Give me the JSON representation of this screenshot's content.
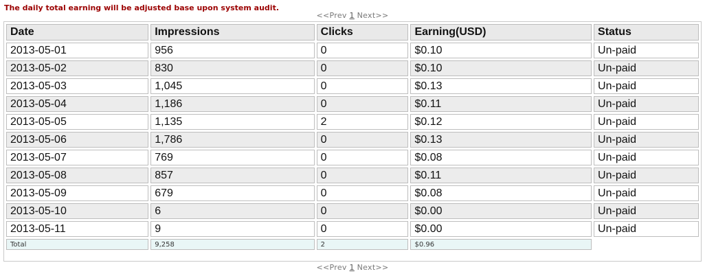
{
  "notice": "The daily total earning will be adjusted base upon system audit.",
  "pager": {
    "prev": "<<Prev",
    "page": "1",
    "next": "Next>>"
  },
  "table": {
    "headers": [
      "Date",
      "Impressions",
      "Clicks",
      "Earning(USD)",
      "Status"
    ],
    "rows": [
      [
        "2013-05-01",
        "956",
        "0",
        "$0.10",
        "Un-paid"
      ],
      [
        "2013-05-02",
        "830",
        "0",
        "$0.10",
        "Un-paid"
      ],
      [
        "2013-05-03",
        "1,045",
        "0",
        "$0.13",
        "Un-paid"
      ],
      [
        "2013-05-04",
        "1,186",
        "0",
        "$0.11",
        "Un-paid"
      ],
      [
        "2013-05-05",
        "1,135",
        "2",
        "$0.12",
        "Un-paid"
      ],
      [
        "2013-05-06",
        "1,786",
        "0",
        "$0.13",
        "Un-paid"
      ],
      [
        "2013-05-07",
        "769",
        "0",
        "$0.08",
        "Un-paid"
      ],
      [
        "2013-05-08",
        "857",
        "0",
        "$0.11",
        "Un-paid"
      ],
      [
        "2013-05-09",
        "679",
        "0",
        "$0.08",
        "Un-paid"
      ],
      [
        "2013-05-10",
        "6",
        "0",
        "$0.00",
        "Un-paid"
      ],
      [
        "2013-05-11",
        "9",
        "0",
        "$0.00",
        "Un-paid"
      ]
    ],
    "total": {
      "label": "Total",
      "impressions": "9,258",
      "clicks": "2",
      "earning": "$0.96"
    }
  },
  "colors": {
    "notice_text": "#9b0000",
    "header_bg": "#e9e9e9",
    "row_alt_bg": "#ececec",
    "total_bg": "#e9f6f6"
  }
}
